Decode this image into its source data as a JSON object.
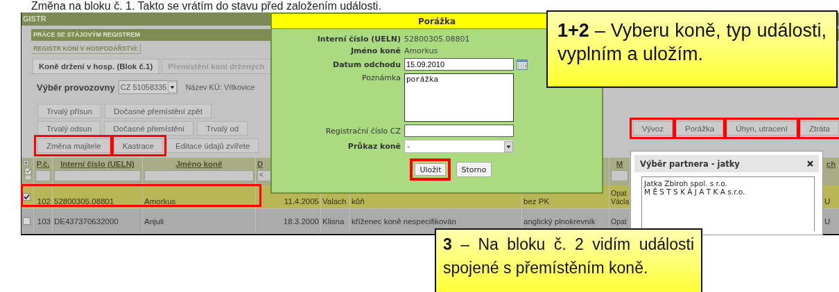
{
  "document_heading": "Změna na bloku č. 1. Takto se vrátím do stavu před založením události.",
  "app": {
    "title": "GISTR",
    "section": "PRÁCE SE STÁJOVÝM REGISTREM",
    "subsection": "REGISTR KONÍ V HOSPODÁŘSTVÍ:",
    "tabs": [
      {
        "label": "Koně držení v hosp. (Blok č.1)",
        "selected": true
      },
      {
        "label": "Přemístění koní držených",
        "selected": false
      }
    ],
    "facility": {
      "label": "Výběr provozovny",
      "value": "CZ 51058335",
      "district": "Název KÚ: Vítkovice"
    },
    "button_rows": [
      {
        "left": [
          {
            "label": "Trvalý přísun",
            "marked": false
          },
          {
            "label": "Dočasné přemístění zpět",
            "marked": false
          }
        ]
      },
      {
        "left": [
          {
            "label": "Trvalý odsun",
            "marked": false
          },
          {
            "label": "Dočasné přemístění",
            "marked": false
          },
          {
            "label": "Trvalý od",
            "marked": false
          }
        ],
        "right": [
          {
            "label": "Vývoz",
            "marked": true
          },
          {
            "label": "Porážka",
            "marked": true
          },
          {
            "label": "Úhyn, utracení",
            "marked": true
          },
          {
            "label": "Ztráta",
            "marked": true
          }
        ]
      },
      {
        "left": [
          {
            "label": "Změna majitele",
            "marked": true
          },
          {
            "label": "Kastrace",
            "marked": true
          },
          {
            "label": "Editace údajů zvířete",
            "marked": false
          }
        ]
      }
    ],
    "table": {
      "columns": [
        {
          "label": "P.č.",
          "filter": true
        },
        {
          "label": "Interní číslo (UELN)",
          "filter": true
        },
        {
          "label": "Jméno koně",
          "filter": true
        },
        {
          "label": "D",
          "filter": true,
          "filter_value": "<"
        },
        {},
        {},
        {},
        {
          "label": "M",
          "filter": true
        },
        {},
        {
          "label": "ch"
        }
      ],
      "rows": [
        {
          "selected": true,
          "checked": true,
          "marked": true,
          "cells": [
            "102",
            "52800305.08801",
            "Amorkus",
            "11.4.2005",
            "Valach",
            "kůň",
            "bez PK",
            "Opat Václa",
            "",
            "U"
          ]
        },
        {
          "selected": false,
          "checked": false,
          "marked": false,
          "cells": [
            "103",
            "DE437370632000",
            "Anjuli",
            "18.3.2000",
            "Klisna",
            "kříženec koně nespecifikován",
            "anglický plnokrevník",
            "Opat",
            "",
            "U"
          ]
        }
      ]
    }
  },
  "dialog": {
    "title": "Porážka",
    "fields": [
      {
        "kind": "text",
        "label": "Interní číslo (UELN)",
        "required": true,
        "value": "52800305.08801"
      },
      {
        "kind": "text",
        "label": "Jméno koně",
        "required": true,
        "value": "Amorkus"
      },
      {
        "kind": "date",
        "label": "Datum odchodu",
        "required": true,
        "value": "15.09.2010"
      },
      {
        "kind": "textarea",
        "label": "Poznámka",
        "required": false,
        "value": "porážka"
      },
      {
        "kind": "input",
        "label": "Registrační číslo CZ",
        "required": false
      },
      {
        "kind": "select",
        "label": "Průkaz koně",
        "required": true,
        "value": "-"
      }
    ],
    "buttons": [
      {
        "label": "Uložit",
        "marked": true
      },
      {
        "label": "Storno",
        "marked": false
      }
    ]
  },
  "partner_dialog": {
    "title": "Výběr partnera - jatky",
    "items": [
      "Jatka Zbiroh spol. s r.o.",
      "M Ě S T S K Á J A T K A s.r.o."
    ]
  },
  "callouts": [
    {
      "text": "**1+2** – Vyberu koně, typ události, vyplním a uložím."
    },
    {
      "text": "**3** – Na bloku č. 2 vidím události spojené s přemístěním koně."
    }
  ]
}
